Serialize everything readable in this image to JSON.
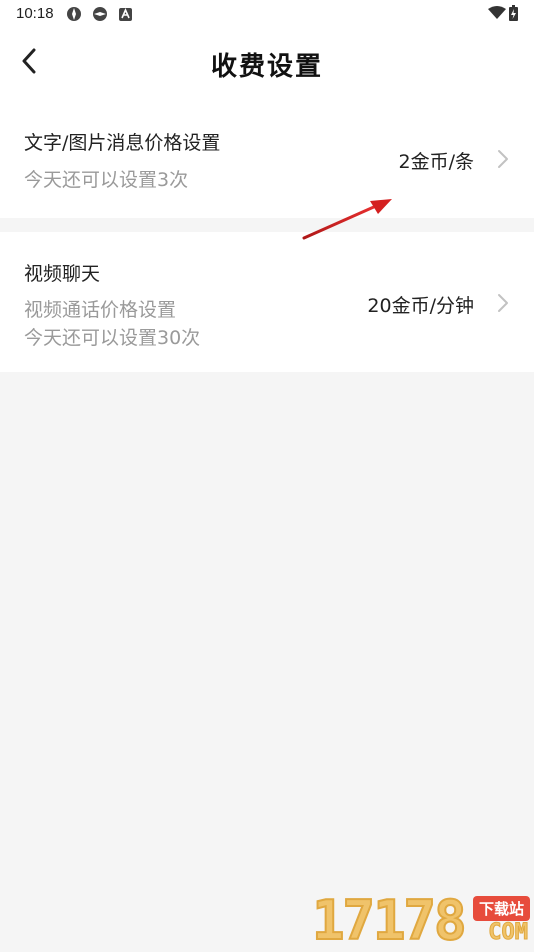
{
  "status_bar": {
    "time": "10:18"
  },
  "header": {
    "title": "收费设置",
    "back_icon": "chevron-left-icon"
  },
  "settings": [
    {
      "title": "文字/图片消息价格设置",
      "subtitle_lines": [
        "今天还可以设置3次"
      ],
      "value": "2金币/条"
    },
    {
      "title": "视频聊天",
      "subtitle_lines": [
        "视频通话价格设置",
        "今天还可以设置30次"
      ],
      "value": "20金币/分钟"
    }
  ],
  "watermark": {
    "number": "17178",
    "badge": "下载站",
    "suffix": "COM"
  },
  "colors": {
    "background": "#f5f5f5",
    "card": "#ffffff",
    "subtitle": "#9a9a9a",
    "annotation_arrow": "#d42020"
  }
}
